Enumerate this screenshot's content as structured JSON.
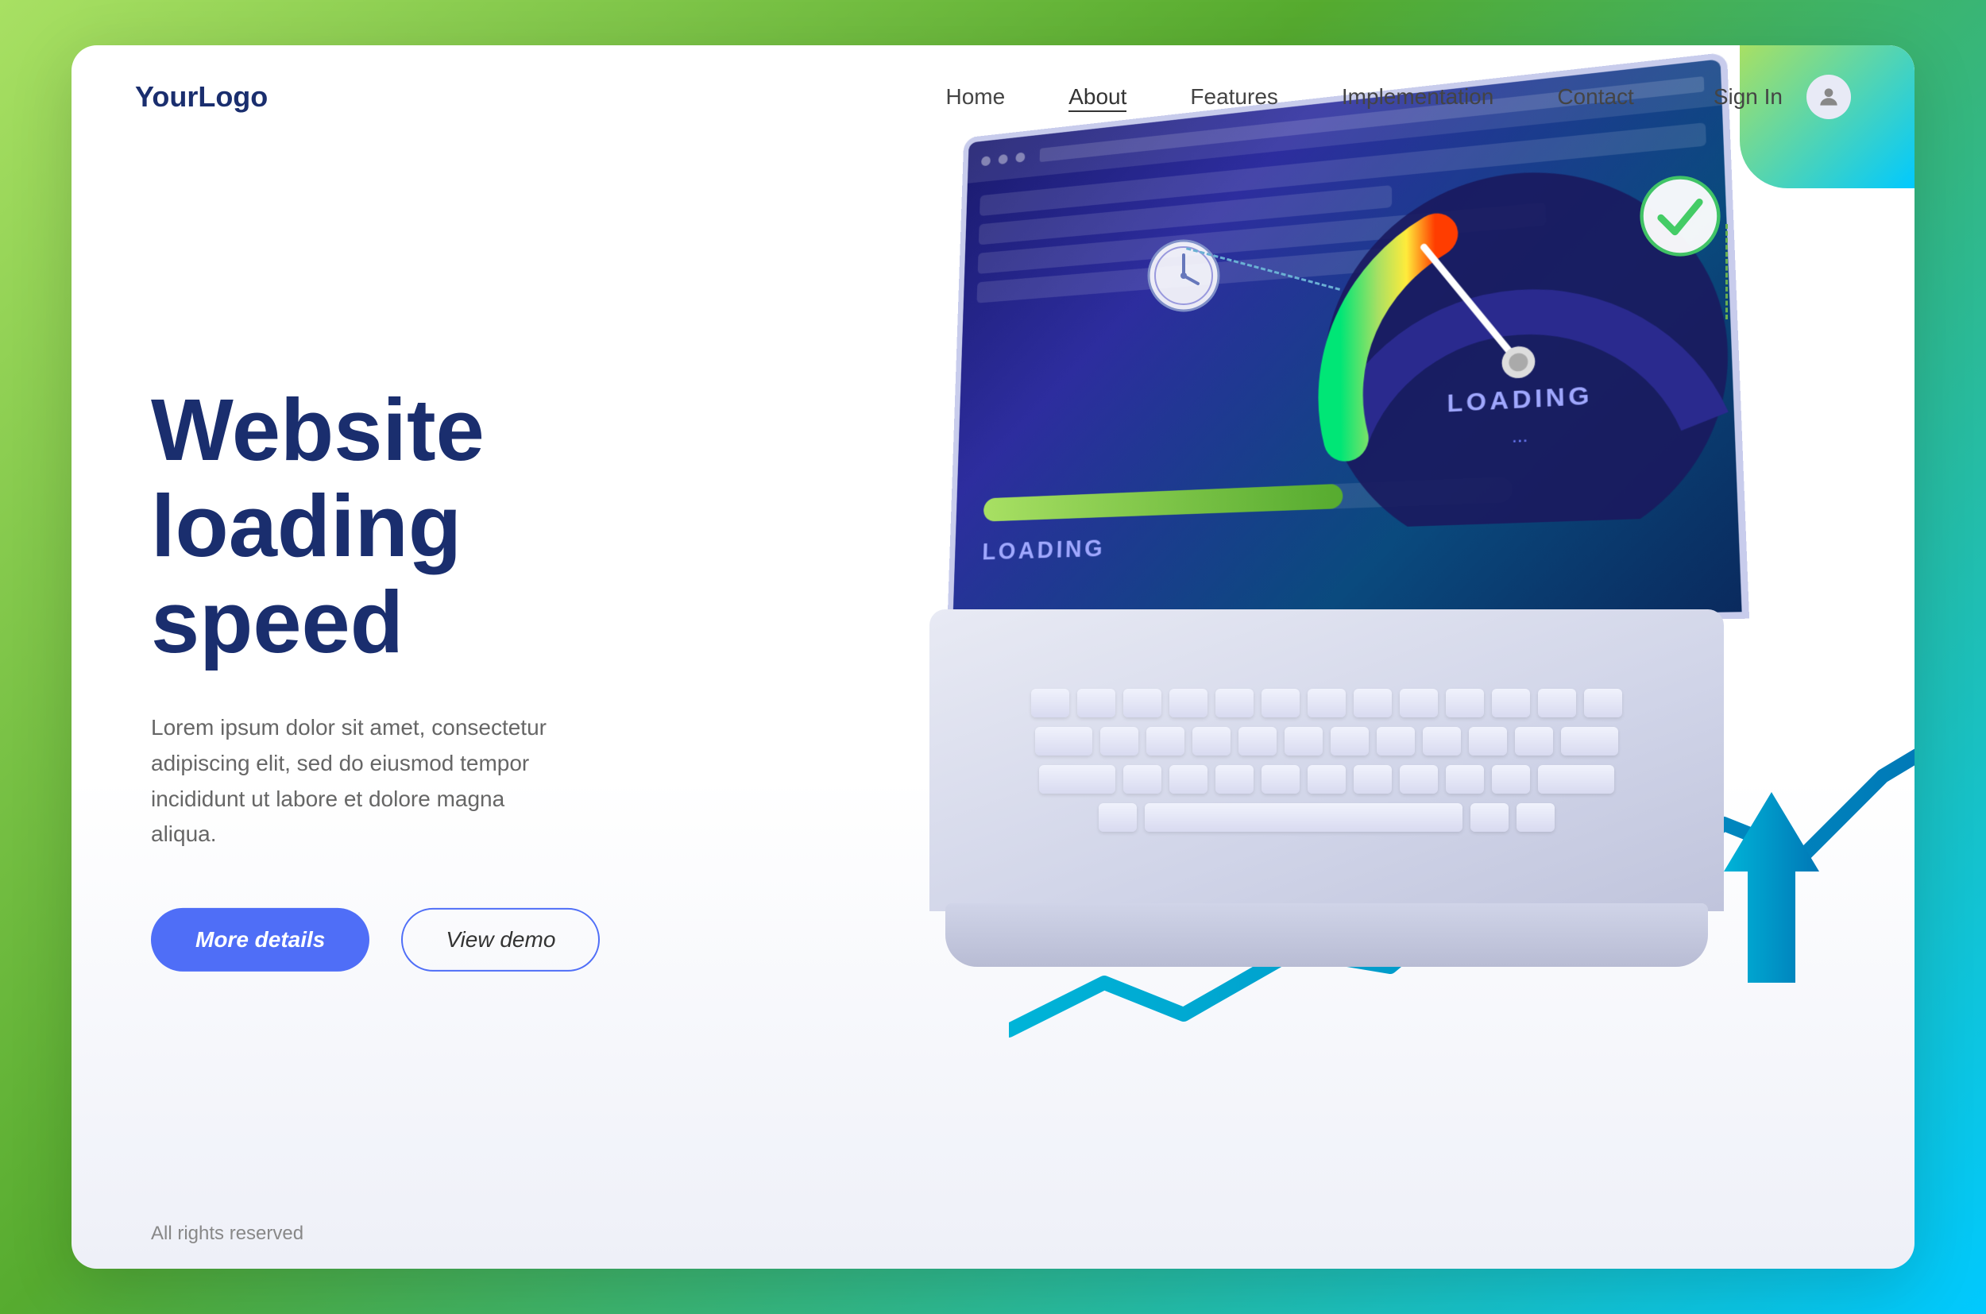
{
  "brand": {
    "logo": "YourLogo"
  },
  "nav": {
    "links": [
      {
        "label": "Home",
        "active": false
      },
      {
        "label": "About",
        "active": true
      },
      {
        "label": "Features",
        "active": false
      },
      {
        "label": "Implementation",
        "active": false
      },
      {
        "label": "Contact",
        "active": false
      }
    ],
    "sign_in": "Sign In"
  },
  "hero": {
    "title_line1": "Website",
    "title_line2": "loading speed",
    "subtitle": "Lorem ipsum dolor sit amet, consectetur adipiscing elit, sed do eiusmod tempor incididunt ut labore et dolore magna aliqua.",
    "btn_primary": "More details",
    "btn_secondary": "View demo"
  },
  "screen": {
    "loading_label": "LOADING...",
    "gauge_label": "LOADING"
  },
  "footer": {
    "rights": "All rights reserved"
  },
  "colors": {
    "primary_blue": "#4f6ef7",
    "dark_navy": "#1a2e6e",
    "green_accent": "#a8e063",
    "cyan_accent": "#00c9ff"
  }
}
